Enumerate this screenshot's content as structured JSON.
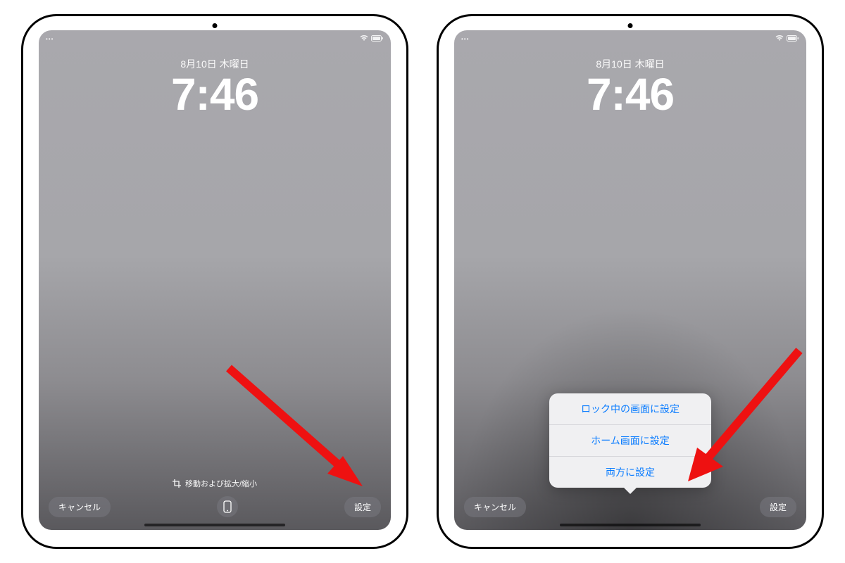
{
  "left": {
    "status": {
      "dots": "•••",
      "wifi": "wifi",
      "battery": "batt"
    },
    "date": "8月10日 木曜日",
    "time": "7:46",
    "hint": "移動および拡大/縮小",
    "cancel": "キャンセル",
    "set": "設定"
  },
  "right": {
    "status": {
      "dots": "•••",
      "wifi": "wifi",
      "battery": "batt"
    },
    "date": "8月10日 木曜日",
    "time": "7:46",
    "cancel": "キャンセル",
    "set": "設定",
    "popover": {
      "lock": "ロック中の画面に設定",
      "home": "ホーム画面に設定",
      "both": "両方に設定"
    }
  }
}
